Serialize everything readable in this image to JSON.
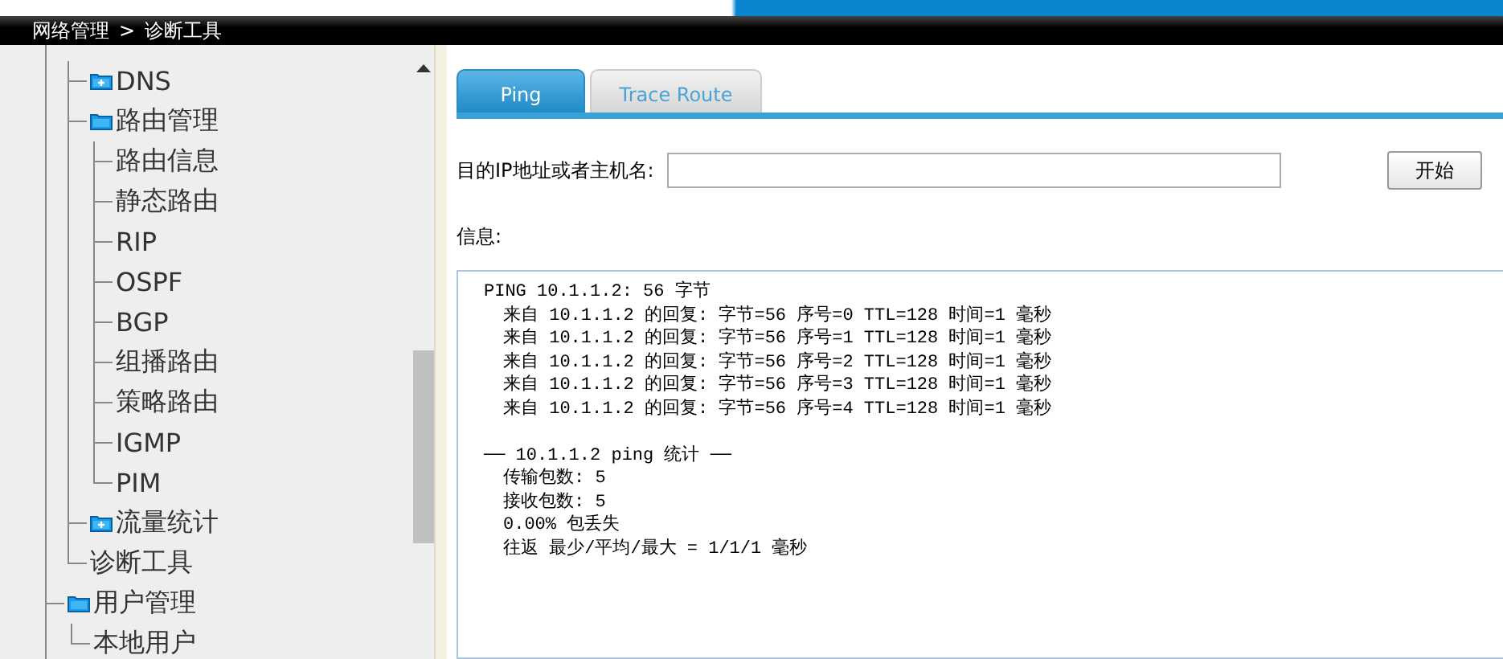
{
  "breadcrumb": {
    "parent": "网络管理",
    "separator": ">",
    "current": "诊断工具"
  },
  "sidebar": {
    "continued_items": [
      {
        "label": "DNS",
        "kind": "folder",
        "expanded": false
      },
      {
        "label": "路由管理",
        "kind": "folder",
        "expanded": true,
        "children": [
          {
            "label": "路由信息",
            "kind": "leaf"
          },
          {
            "label": "静态路由",
            "kind": "leaf"
          },
          {
            "label": "RIP",
            "kind": "leaf"
          },
          {
            "label": "OSPF",
            "kind": "leaf"
          },
          {
            "label": "BGP",
            "kind": "leaf"
          },
          {
            "label": "组播路由",
            "kind": "leaf"
          },
          {
            "label": "策略路由",
            "kind": "leaf"
          },
          {
            "label": "IGMP",
            "kind": "leaf"
          },
          {
            "label": "PIM",
            "kind": "leaf"
          }
        ]
      },
      {
        "label": "流量统计",
        "kind": "folder",
        "expanded": false
      },
      {
        "label": "诊断工具",
        "kind": "leaf"
      }
    ],
    "items": [
      {
        "label": "用户管理",
        "kind": "folder",
        "expanded": true,
        "children": [
          {
            "label": "本地用户",
            "kind": "leaf"
          }
        ]
      }
    ]
  },
  "tabs": [
    {
      "label": "Ping",
      "selected": true
    },
    {
      "label": "Trace Route",
      "selected": false
    }
  ],
  "form": {
    "label": "目的IP地址或者主机名:",
    "button": "开始"
  },
  "output": {
    "label": "信息:",
    "blocks": [
      [
        {
          "text": "PING 10.1.1.2: 56 字节",
          "indent": false
        },
        {
          "text": "来自 10.1.1.2 的回复: 字节=56 序号=0 TTL=128 时间=1 毫秒",
          "indent": true
        },
        {
          "text": "来自 10.1.1.2 的回复: 字节=56 序号=1 TTL=128 时间=1 毫秒",
          "indent": true
        },
        {
          "text": "来自 10.1.1.2 的回复: 字节=56 序号=2 TTL=128 时间=1 毫秒",
          "indent": true
        },
        {
          "text": "来自 10.1.1.2 的回复: 字节=56 序号=3 TTL=128 时间=1 毫秒",
          "indent": true
        },
        {
          "text": "来自 10.1.1.2 的回复: 字节=56 序号=4 TTL=128 时间=1 毫秒",
          "indent": true
        }
      ],
      [
        {
          "text": "── 10.1.1.2 ping 统计 ──",
          "indent": false
        },
        {
          "text": "传输包数: 5",
          "indent": true
        },
        {
          "text": "接收包数: 5",
          "indent": true
        },
        {
          "text": "0.00% 包丢失",
          "indent": true
        },
        {
          "text": "往返 最少/平均/最大 = 1/1/1 毫秒",
          "indent": true
        }
      ]
    ]
  }
}
